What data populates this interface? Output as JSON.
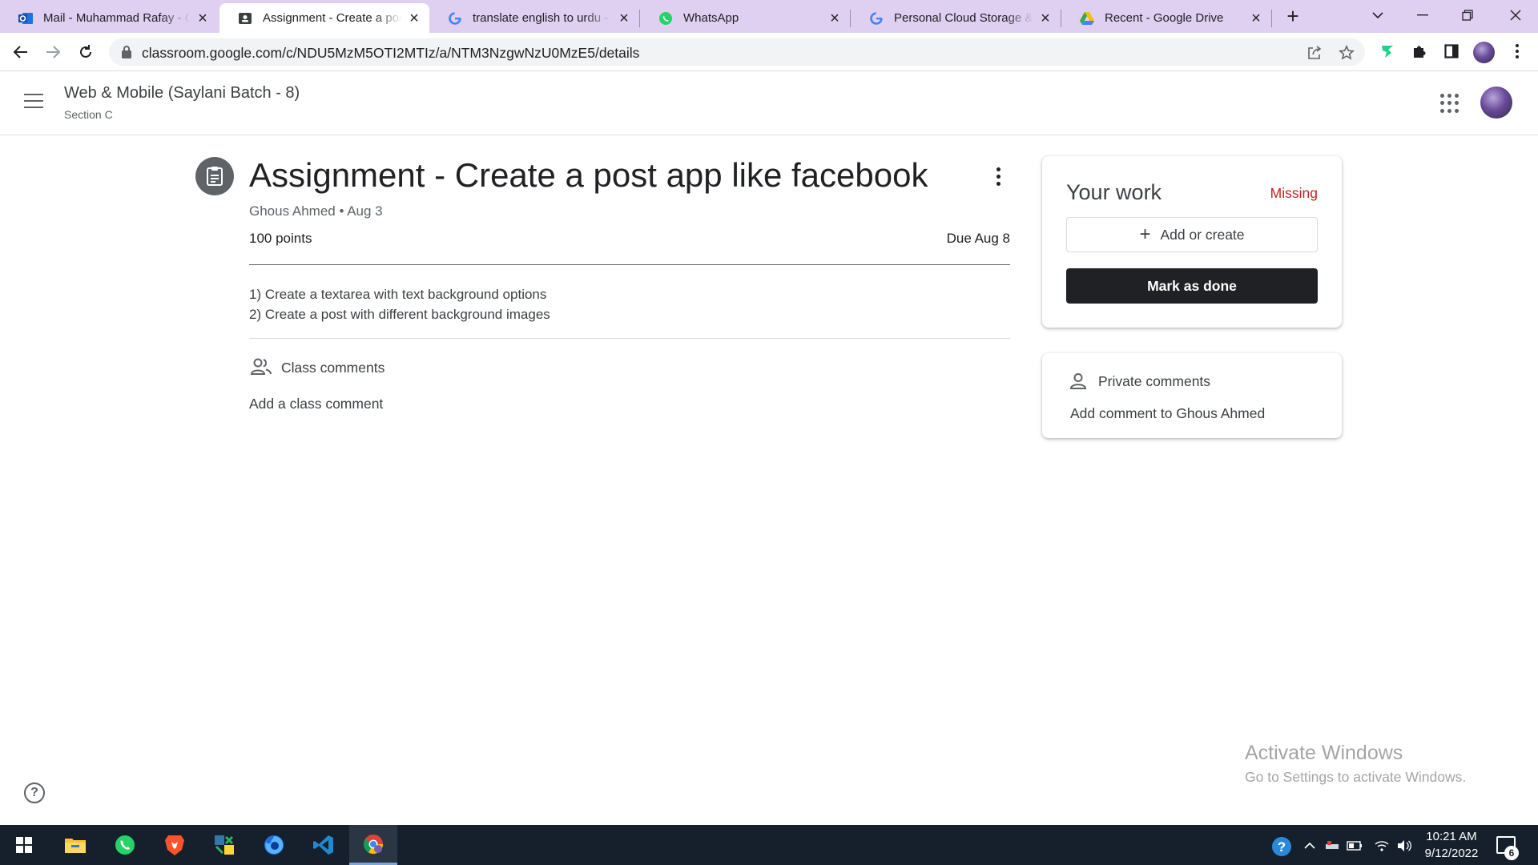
{
  "browser": {
    "tabs": [
      {
        "title": "Mail - Muhammad Rafay - O",
        "icon": "outlook-icon",
        "active": false
      },
      {
        "title": "Assignment - Create a post",
        "icon": "classroom-icon",
        "active": true
      },
      {
        "title": "translate english to urdu - G",
        "icon": "google-icon",
        "active": false
      },
      {
        "title": "WhatsApp",
        "icon": "whatsapp-icon",
        "active": false
      },
      {
        "title": "Personal Cloud Storage & F",
        "icon": "google-icon",
        "active": false
      },
      {
        "title": "Recent - Google Drive",
        "icon": "drive-icon",
        "active": false
      }
    ],
    "url": "classroom.google.com/c/NDU5MzM5OTI2MTIz/a/NTM3NzgwNzU0MzE5/details",
    "new_tab_label": "+"
  },
  "header": {
    "course_name": "Web & Mobile (Saylani Batch - 8)",
    "section": "Section C"
  },
  "assignment": {
    "title": "Assignment - Create a post app like facebook",
    "author": "Ghous Ahmed",
    "posted": "Aug 3",
    "meta": "Ghous Ahmed • Aug 3",
    "points": "100 points",
    "due": "Due Aug 8",
    "instructions": [
      "1) Create a textarea with text background options",
      "2) Create a post with different background images"
    ]
  },
  "class_comments": {
    "label": "Class comments",
    "add_label": "Add a class comment"
  },
  "your_work": {
    "title": "Your work",
    "status": "Missing",
    "status_color": "#c5221f",
    "add_button": "Add or create",
    "done_button": "Mark as done"
  },
  "private_comments": {
    "label": "Private comments",
    "add_label": "Add comment to Ghous Ahmed"
  },
  "watermark": {
    "line1": "Activate Windows",
    "line2": "Go to Settings to activate Windows."
  },
  "taskbar": {
    "time": "10:21 AM",
    "date": "9/12/2022",
    "notifications": "6",
    "apps": [
      "windows-start-icon",
      "file-explorer-icon",
      "whatsapp-icon",
      "brave-icon",
      "python-idle-icon",
      "firefox-icon",
      "vscode-icon",
      "chrome-icon"
    ]
  }
}
